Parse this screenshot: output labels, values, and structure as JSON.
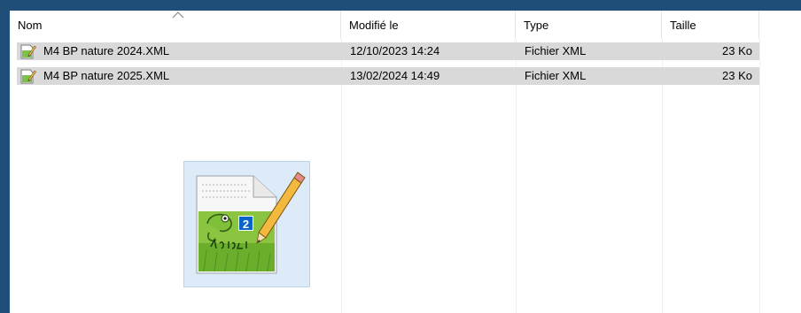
{
  "columns": {
    "name": "Nom",
    "modified": "Modifié le",
    "type": "Type",
    "size": "Taille"
  },
  "files": [
    {
      "name": "M4 BP nature 2024.XML",
      "modified": "12/10/2023 14:24",
      "type": "Fichier XML",
      "size": "23 Ko",
      "icon": "notepadpp-file-icon"
    },
    {
      "name": "M4 BP nature 2025.XML",
      "modified": "13/02/2024 14:49",
      "type": "Fichier XML",
      "size": "23 Ko",
      "icon": "notepadpp-file-icon"
    }
  ],
  "drag": {
    "count": "2",
    "icon": "notepadpp-drag-icon"
  },
  "colors": {
    "selection": "#d9d9d9",
    "desktop": "#1f4e79",
    "badge": "#0a63c9"
  }
}
